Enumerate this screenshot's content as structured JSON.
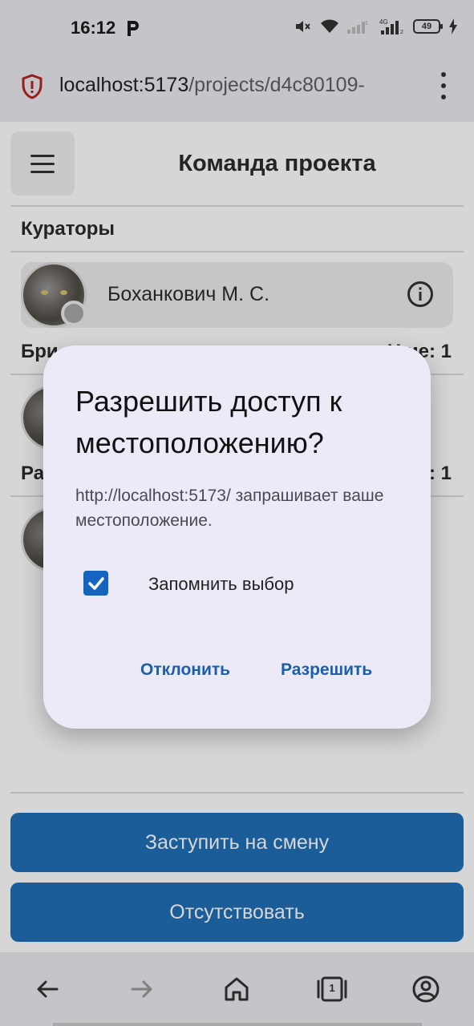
{
  "status_bar": {
    "time": "16:12",
    "battery": "49",
    "network": "4G"
  },
  "browser": {
    "url_host": "localhost:5173",
    "url_path": "/projects/d4c80109-",
    "icons": [
      "shield-alert-icon",
      "more-vert-icon"
    ]
  },
  "app": {
    "title": "Команда проекта",
    "sections": [
      {
        "label": "Кураторы",
        "count": ""
      },
      {
        "label": "Бри",
        "count": "Н      ие: 1"
      },
      {
        "label": "Ра",
        "count": ": 1"
      }
    ],
    "curator": {
      "name": "Боханкович М. С.",
      "status": "offline"
    },
    "actions": {
      "start_shift": "Заступить на смену",
      "absent": "Отсутствовать"
    }
  },
  "dialog": {
    "title": "Разрешить доступ к местоположению?",
    "body": "http://localhost:5173/ запрашивает ваше местоположение.",
    "remember_label": "Запомнить выбор",
    "remember_checked": true,
    "deny_label": "Отклонить",
    "allow_label": "Разрешить"
  },
  "bottom_nav": {
    "tab_count": "1",
    "items": [
      "back-icon",
      "forward-icon",
      "home-icon",
      "tabs-icon",
      "account-icon"
    ]
  },
  "colors": {
    "accent": "#1f6fb5",
    "dialog_bg": "#eceaf6",
    "dialog_button": "#1a5fa8",
    "checkbox": "#1565c0"
  }
}
